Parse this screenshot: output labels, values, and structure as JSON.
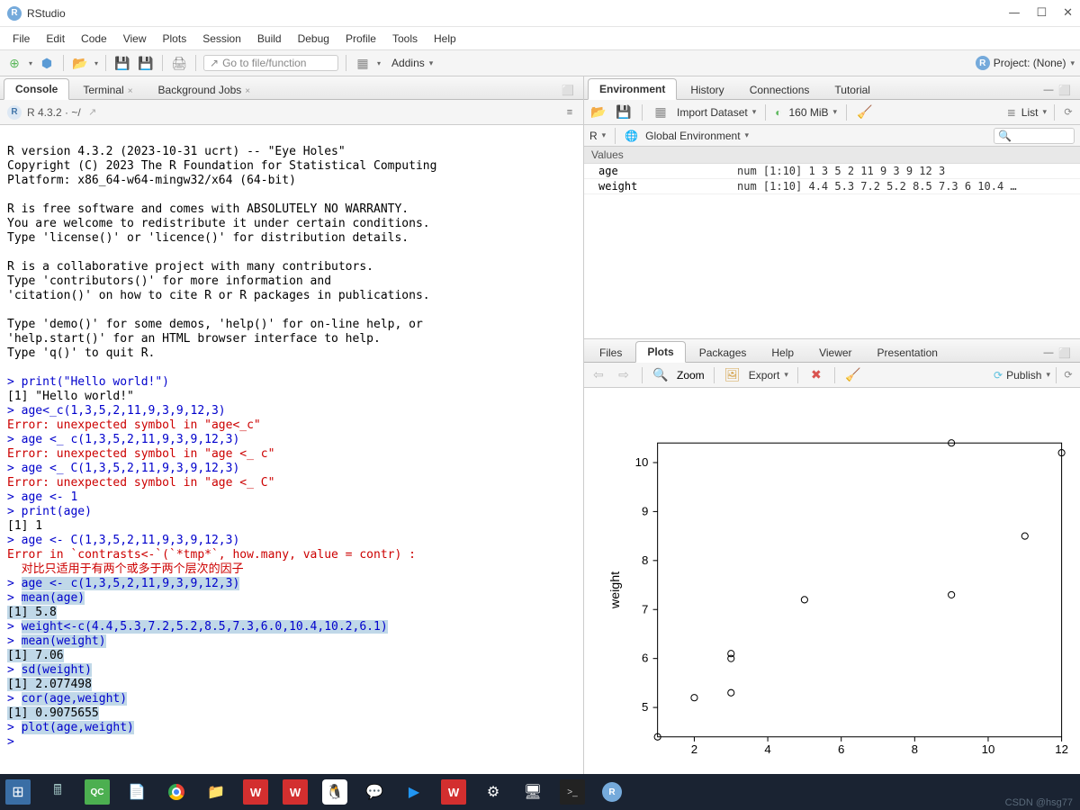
{
  "app": {
    "title": "RStudio"
  },
  "menu": [
    "File",
    "Edit",
    "Code",
    "View",
    "Plots",
    "Session",
    "Build",
    "Debug",
    "Profile",
    "Tools",
    "Help"
  ],
  "toolbar": {
    "go_to_placeholder": "Go to file/function",
    "addins": "Addins",
    "project": "Project: (None)"
  },
  "left_tabs": {
    "items": [
      {
        "label": "Console",
        "active": true
      },
      {
        "label": "Terminal",
        "active": false,
        "closable": true
      },
      {
        "label": "Background Jobs",
        "active": false,
        "closable": true
      }
    ],
    "sub": {
      "version": "R 4.3.2",
      "path": " · ~/"
    }
  },
  "console_lines": [
    {
      "t": "",
      "c": ""
    },
    {
      "t": "R version 4.3.2 (2023-10-31 ucrt) -- \"Eye Holes\"",
      "c": ""
    },
    {
      "t": "Copyright (C) 2023 The R Foundation for Statistical Computing",
      "c": ""
    },
    {
      "t": "Platform: x86_64-w64-mingw32/x64 (64-bit)",
      "c": ""
    },
    {
      "t": "",
      "c": ""
    },
    {
      "t": "R is free software and comes with ABSOLUTELY NO WARRANTY.",
      "c": ""
    },
    {
      "t": "You are welcome to redistribute it under certain conditions.",
      "c": ""
    },
    {
      "t": "Type 'license()' or 'licence()' for distribution details.",
      "c": ""
    },
    {
      "t": "",
      "c": ""
    },
    {
      "t": "R is a collaborative project with many contributors.",
      "c": ""
    },
    {
      "t": "Type 'contributors()' for more information and",
      "c": ""
    },
    {
      "t": "'citation()' on how to cite R or R packages in publications.",
      "c": ""
    },
    {
      "t": "",
      "c": ""
    },
    {
      "t": "Type 'demo()' for some demos, 'help()' for on-line help, or",
      "c": ""
    },
    {
      "t": "'help.start()' for an HTML browser interface to help.",
      "c": ""
    },
    {
      "t": "Type 'q()' to quit R.",
      "c": ""
    },
    {
      "t": "",
      "c": ""
    },
    {
      "t": "> print(\"Hello world!\")",
      "c": "blue"
    },
    {
      "t": "[1] \"Hello world!\"",
      "c": ""
    },
    {
      "t": "> age<_c(1,3,5,2,11,9,3,9,12,3)",
      "c": "blue"
    },
    {
      "t": "Error: unexpected symbol in \"age<_c\"",
      "c": "red"
    },
    {
      "t": "> age <_ c(1,3,5,2,11,9,3,9,12,3)",
      "c": "blue"
    },
    {
      "t": "Error: unexpected symbol in \"age <_ c\"",
      "c": "red"
    },
    {
      "t": "> age <_ C(1,3,5,2,11,9,3,9,12,3)",
      "c": "blue"
    },
    {
      "t": "Error: unexpected symbol in \"age <_ C\"",
      "c": "red"
    },
    {
      "t": "> age <- 1",
      "c": "blue"
    },
    {
      "t": "> print(age)",
      "c": "blue"
    },
    {
      "t": "[1] 1",
      "c": ""
    },
    {
      "t": "> age <- C(1,3,5,2,11,9,3,9,12,3)",
      "c": "blue"
    },
    {
      "t": "Error in `contrasts<-`(`*tmp*`, how.many, value = contr) :",
      "c": "red"
    },
    {
      "t": "  对比只适用于有两个或多于两个层次的因子",
      "c": "red"
    },
    {
      "t": "> age <- c(1,3,5,2,11,9,3,9,12,3)",
      "c": "blue",
      "sel": true,
      "selpart": "age <- c(1,3,5,2,11,9,3,9,12,3)"
    },
    {
      "t": "> mean(age)",
      "c": "blue",
      "sel": true,
      "selpart": "mean(age)"
    },
    {
      "t": "[1] 5.8",
      "c": "",
      "sel": true,
      "selpart": "[1] 5.8"
    },
    {
      "t": "> weight<-c(4.4,5.3,7.2,5.2,8.5,7.3,6.0,10.4,10.2,6.1)",
      "c": "blue",
      "sel": true,
      "selpart": "weight<-c(4.4,5.3,7.2,5.2,8.5,7.3,6.0,10.4,10.2,6.1)"
    },
    {
      "t": "> mean(weight)",
      "c": "blue",
      "sel": true,
      "selpart": "mean(weight)"
    },
    {
      "t": "[1] 7.06",
      "c": "",
      "sel": true,
      "selpart": "[1] 7.06"
    },
    {
      "t": "> sd(weight)",
      "c": "blue",
      "sel": true,
      "selpart": "sd(weight)"
    },
    {
      "t": "[1] 2.077498",
      "c": "",
      "sel": true,
      "selpart": "[1] 2.077498"
    },
    {
      "t": "> cor(age,weight)",
      "c": "blue",
      "sel": true,
      "selpart": "cor(age,weight)"
    },
    {
      "t": "[1] 0.9075655",
      "c": "",
      "sel": true,
      "selpart": "[1] 0.9075655"
    },
    {
      "t": "> plot(age,weight)",
      "c": "blue",
      "sel": true,
      "selpart": "plot(age,weight)"
    },
    {
      "t": "> ",
      "c": "blue",
      "sel": true,
      "selpart": ""
    }
  ],
  "env_tabs": [
    {
      "label": "Environment",
      "active": true
    },
    {
      "label": "History",
      "active": false
    },
    {
      "label": "Connections",
      "active": false
    },
    {
      "label": "Tutorial",
      "active": false
    }
  ],
  "env_toolbar": {
    "import": "Import Dataset",
    "mem": "160 MiB",
    "list": "List",
    "scope_r": "R",
    "scope_env": "Global Environment"
  },
  "env": {
    "header": "Values",
    "rows": [
      {
        "name": "age",
        "value": "num [1:10] 1 3 5 2 11 9 3 9 12 3"
      },
      {
        "name": "weight",
        "value": "num [1:10] 4.4 5.3 7.2 5.2 8.5 7.3 6 10.4 …"
      }
    ]
  },
  "plot_tabs": [
    {
      "label": "Files",
      "active": false
    },
    {
      "label": "Plots",
      "active": true
    },
    {
      "label": "Packages",
      "active": false
    },
    {
      "label": "Help",
      "active": false
    },
    {
      "label": "Viewer",
      "active": false
    },
    {
      "label": "Presentation",
      "active": false
    }
  ],
  "plot_toolbar": {
    "zoom": "Zoom",
    "export": "Export",
    "publish": "Publish"
  },
  "chart_data": {
    "type": "scatter",
    "xlabel": "",
    "ylabel": "weight",
    "xlim": [
      1,
      12
    ],
    "ylim": [
      4.4,
      10.4
    ],
    "xticks": [
      2,
      4,
      6,
      8,
      10,
      12
    ],
    "yticks": [
      5,
      6,
      7,
      8,
      9,
      10
    ],
    "points": [
      {
        "x": 1,
        "y": 4.4
      },
      {
        "x": 3,
        "y": 5.3
      },
      {
        "x": 5,
        "y": 7.2
      },
      {
        "x": 2,
        "y": 5.2
      },
      {
        "x": 11,
        "y": 8.5
      },
      {
        "x": 9,
        "y": 7.3
      },
      {
        "x": 3,
        "y": 6.0
      },
      {
        "x": 9,
        "y": 10.4
      },
      {
        "x": 12,
        "y": 10.2
      },
      {
        "x": 3,
        "y": 6.1
      }
    ]
  },
  "watermark": "CSDN @hsg77"
}
